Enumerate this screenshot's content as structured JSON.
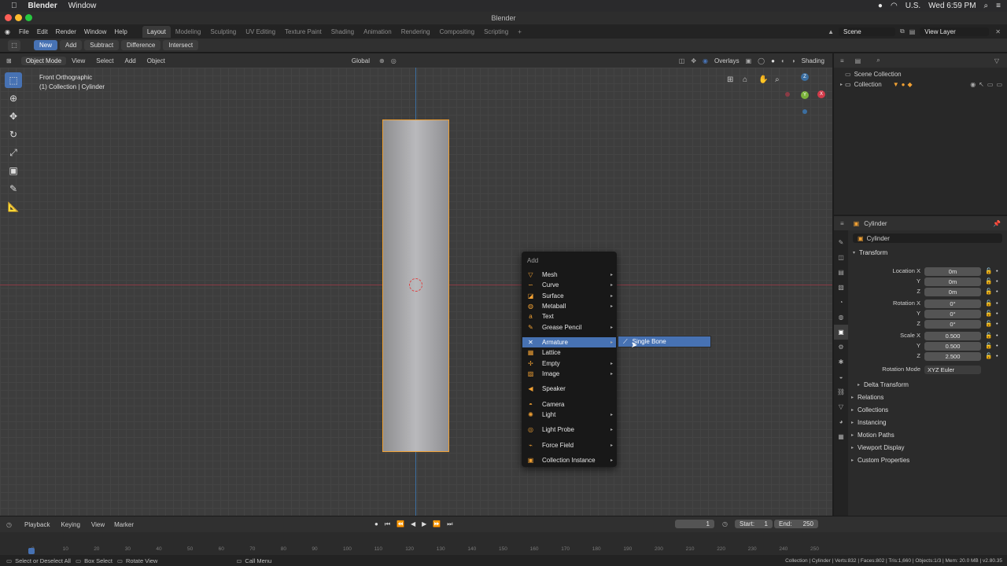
{
  "mac_menubar": {
    "app": "Blender",
    "items": [
      "Window"
    ],
    "input_source": "U.S.",
    "clock": "Wed 6:59 PM"
  },
  "window_title": "Blender",
  "topbar": {
    "menus": [
      "File",
      "Edit",
      "Render",
      "Window",
      "Help"
    ],
    "workspaces": [
      "Layout",
      "Modeling",
      "Sculpting",
      "UV Editing",
      "Texture Paint",
      "Shading",
      "Animation",
      "Rendering",
      "Compositing",
      "Scripting"
    ],
    "active_workspace": "Layout",
    "scene_label": "Scene",
    "view_layer_label": "View Layer"
  },
  "tool_header": {
    "buttons": [
      "New",
      "Add",
      "Subtract",
      "Difference",
      "Intersect"
    ],
    "active": "New"
  },
  "viewport_header": {
    "mode": "Object Mode",
    "menus": [
      "View",
      "Select",
      "Add",
      "Object"
    ],
    "orientation": "Global",
    "overlays": "Overlays",
    "shading": "Shading"
  },
  "viewport": {
    "view_name": "Front Orthographic",
    "collection_info": "(1) Collection | Cylinder",
    "gizmo_axes": {
      "z": "Z",
      "y": "Y",
      "x": "X"
    }
  },
  "add_menu": {
    "title": "Add",
    "items": [
      {
        "label": "Mesh",
        "icon": "mesh-icon",
        "submenu": true
      },
      {
        "label": "Curve",
        "icon": "curve-icon",
        "submenu": true
      },
      {
        "label": "Surface",
        "icon": "surface-icon",
        "submenu": true
      },
      {
        "label": "Metaball",
        "icon": "metaball-icon",
        "submenu": true
      },
      {
        "label": "Text",
        "icon": "text-icon",
        "submenu": false
      },
      {
        "label": "Grease Pencil",
        "icon": "grease-pencil-icon",
        "submenu": true
      },
      {
        "label": "Armature",
        "icon": "armature-icon",
        "submenu": true,
        "highlighted": true
      },
      {
        "label": "Lattice",
        "icon": "lattice-icon",
        "submenu": false
      },
      {
        "label": "Empty",
        "icon": "empty-icon",
        "submenu": true
      },
      {
        "label": "Image",
        "icon": "image-icon",
        "submenu": true
      },
      {
        "label": "Speaker",
        "icon": "speaker-icon",
        "submenu": false
      },
      {
        "label": "Camera",
        "icon": "camera-icon",
        "submenu": false
      },
      {
        "label": "Light",
        "icon": "light-icon",
        "submenu": true
      },
      {
        "label": "Light Probe",
        "icon": "light-probe-icon",
        "submenu": true
      },
      {
        "label": "Force Field",
        "icon": "force-field-icon",
        "submenu": true
      },
      {
        "label": "Collection Instance",
        "icon": "collection-instance-icon",
        "submenu": true
      }
    ],
    "submenu_item": "Single Bone"
  },
  "outliner": {
    "root": "Scene Collection",
    "collection": "Collection"
  },
  "properties": {
    "object_name": "Cylinder",
    "data_name": "Cylinder",
    "section": "Transform",
    "rows": [
      {
        "label": "Location X",
        "value": "0m"
      },
      {
        "label": "Y",
        "value": "0m"
      },
      {
        "label": "Z",
        "value": "0m"
      },
      {
        "label": "Rotation X",
        "value": "0°"
      },
      {
        "label": "Y",
        "value": "0°"
      },
      {
        "label": "Z",
        "value": "0°"
      },
      {
        "label": "Scale X",
        "value": "0.500"
      },
      {
        "label": "Y",
        "value": "0.500"
      },
      {
        "label": "Z",
        "value": "2.500"
      }
    ],
    "rotation_mode_label": "Rotation Mode",
    "rotation_mode_value": "XYZ Euler",
    "delta_transform": "Delta Transform",
    "panels": [
      "Relations",
      "Collections",
      "Instancing",
      "Motion Paths",
      "Viewport Display",
      "Custom Properties"
    ]
  },
  "timeline": {
    "menus": [
      "Playback",
      "Keying",
      "View",
      "Marker"
    ],
    "current_frame": "1",
    "start_label": "Start:",
    "start_value": "1",
    "end_label": "End:",
    "end_value": "250",
    "ruler": [
      "0",
      "10",
      "20",
      "30",
      "40",
      "50",
      "60",
      "70",
      "80",
      "90",
      "100",
      "110",
      "120",
      "130",
      "140",
      "150",
      "160",
      "170",
      "180",
      "190",
      "200",
      "210",
      "220",
      "230",
      "240",
      "250"
    ]
  },
  "statusbar": {
    "hint1": "Select or Deselect All",
    "hint2": "Box Select",
    "hint3": "Rotate View",
    "hint4": "Call Menu",
    "stats": "Collection | Cylinder | Verts:832 | Faces:802 | Tris:1,660 | Objects:1/3 | Mem: 20.0 MB | v2.80.35"
  },
  "colors": {
    "accent": "#4772b3",
    "selection_outline": "#f0a033",
    "axis_x": "#8a3b45",
    "axis_z": "#3b6ea0"
  }
}
